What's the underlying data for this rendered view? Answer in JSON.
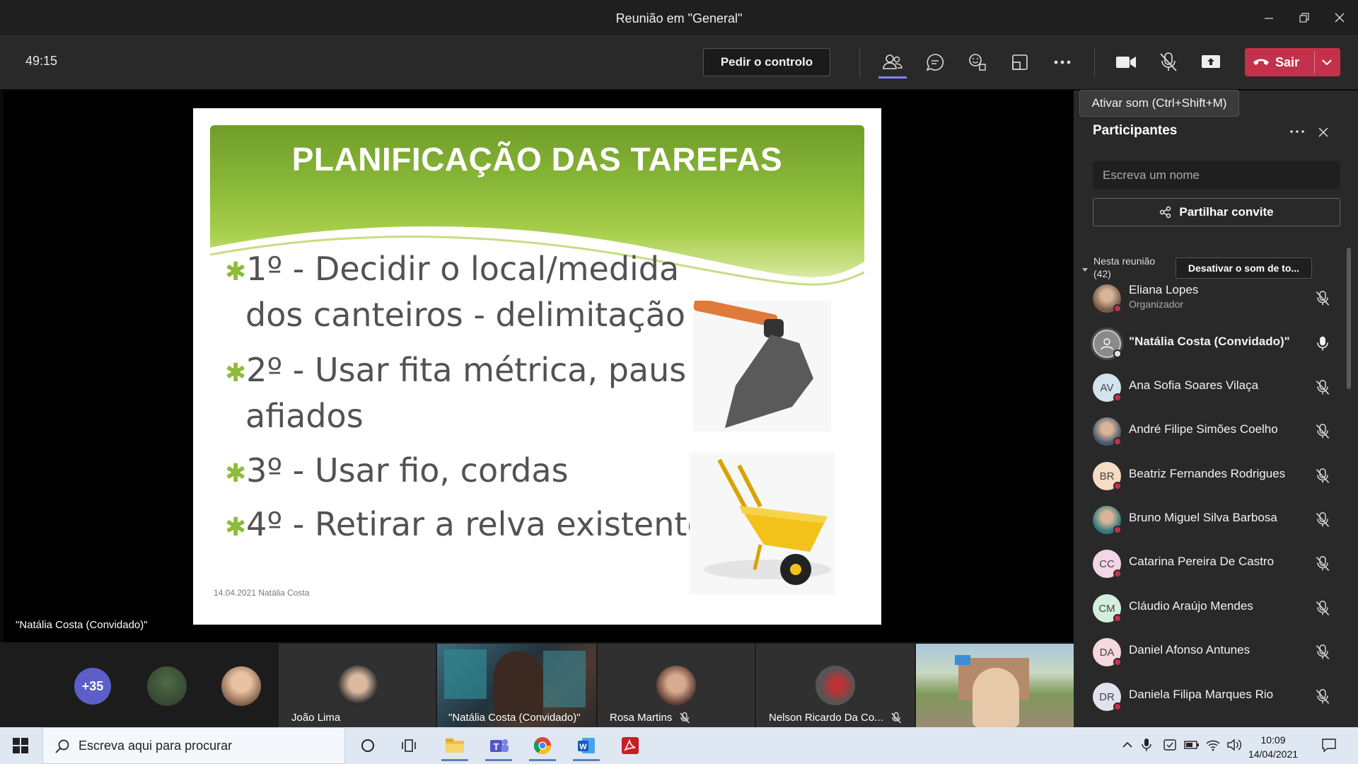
{
  "window": {
    "title": "Reunião em \"General\""
  },
  "toolbar": {
    "timer": "49:15",
    "request_control": "Pedir o controlo",
    "leave": "Sair"
  },
  "tooltip": "Ativar som (Ctrl+Shift+M)",
  "slide": {
    "title": "PLANIFICAÇÃO DAS TAREFAS",
    "bullets": [
      {
        "first": "1º  - Decidir o local/medida",
        "cont": "dos canteiros - delimitação"
      },
      {
        "first": "2º - Usar fita métrica, paus",
        "cont": "afiados"
      },
      {
        "first": "3º - Usar fio, cordas",
        "cont": ""
      },
      {
        "first": "4º - Retirar a relva existente;",
        "cont": ""
      }
    ],
    "footer": "14.04.2021 Natália Costa"
  },
  "stage": {
    "presenter_name": "\"Natália Costa (Convidado)\""
  },
  "strip": {
    "overflow": "+35",
    "tiles": [
      {
        "name": "João Lima"
      },
      {
        "name": "\"Natália Costa (Convidado)\""
      },
      {
        "name": "Rosa Martins"
      },
      {
        "name": "Nelson Ricardo Da Co..."
      }
    ]
  },
  "panel": {
    "title": "Participantes",
    "search_placeholder": "Escreva um nome",
    "share_invite": "Partilhar convite",
    "in_meeting_label": "Nesta reunião",
    "in_meeting_count": "(42)",
    "mute_all": "Desativar o som de to...",
    "participants": [
      {
        "name": "Eliana Lopes",
        "role": "Organizador",
        "initials": "",
        "color": "#7a5a45",
        "mic": "muted"
      },
      {
        "name": "\"Natália Costa (Convidado)\"",
        "role": "",
        "initials": "",
        "color": "#8a8a8a",
        "mic": "active"
      },
      {
        "name": "Ana Sofia Soares Vilaça",
        "role": "",
        "initials": "AV",
        "color": "#d2e3ee",
        "mic": "muted"
      },
      {
        "name": "André Filipe Simões Coelho",
        "role": "",
        "initials": "",
        "color": "#4a5a6a",
        "mic": "muted"
      },
      {
        "name": "Beatriz Fernandes Rodrigues",
        "role": "",
        "initials": "BR",
        "color": "#f6dcc4",
        "mic": "muted"
      },
      {
        "name": "Bruno Miguel Silva Barbosa",
        "role": "",
        "initials": "",
        "color": "#2f7a7a",
        "mic": "muted"
      },
      {
        "name": "Catarina Pereira De Castro",
        "role": "",
        "initials": "CC",
        "color": "#f3d6e6",
        "mic": "muted"
      },
      {
        "name": "Cláudio Araújo Mendes",
        "role": "",
        "initials": "CM",
        "color": "#d4eedd",
        "mic": "muted"
      },
      {
        "name": "Daniel Afonso Antunes",
        "role": "",
        "initials": "DA",
        "color": "#f5d7dd",
        "mic": "muted"
      },
      {
        "name": "Daniela Filipa Marques Rio",
        "role": "",
        "initials": "DR",
        "color": "#e2e2ee",
        "mic": "muted"
      }
    ]
  },
  "taskbar": {
    "search_text": "Escreva aqui para procurar",
    "time": "10:09",
    "date": "14/04/2021"
  }
}
